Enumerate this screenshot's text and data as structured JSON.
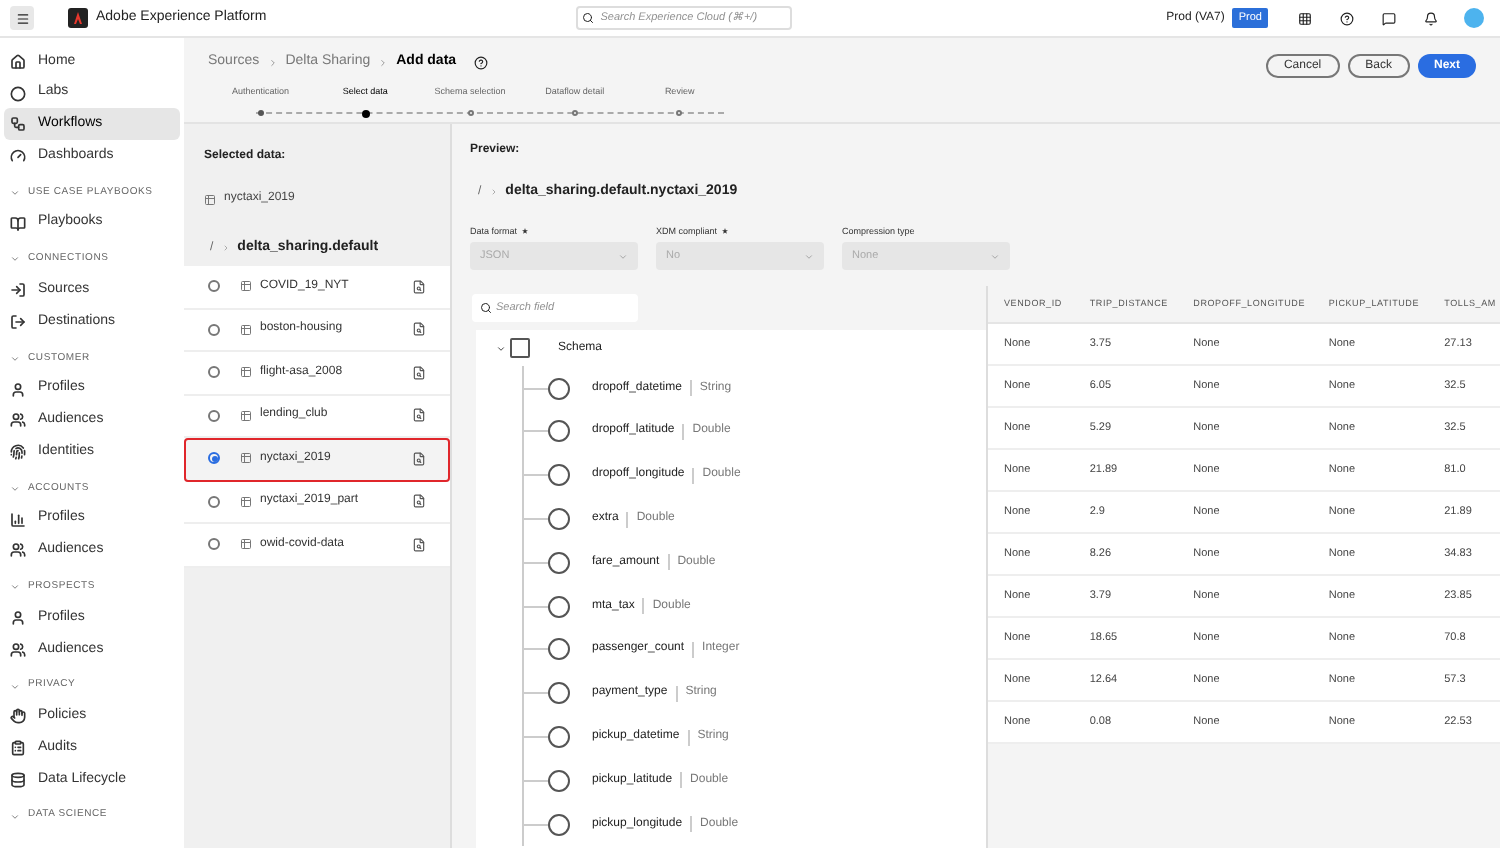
{
  "top_bar": {
    "title": "Adobe Experience Platform",
    "search": {
      "placeholder": "Search Experience Cloud (⌘+/)"
    },
    "sandbox": "Prod (VA7)",
    "badge": "Prod"
  },
  "sidebar": {
    "items": [
      {
        "label": "Home",
        "selected": false
      },
      {
        "label": "Labs",
        "selected": false
      },
      {
        "label": "Workflows",
        "selected": true
      },
      {
        "label": "Dashboards",
        "selected": false
      }
    ],
    "sections": [
      {
        "title": "USE CASE PLAYBOOKS",
        "expanded": true,
        "items": [
          {
            "label": "Playbooks",
            "selected": false
          }
        ]
      },
      {
        "title": "CONNECTIONS",
        "expanded": true,
        "items": [
          {
            "label": "Sources",
            "selected": false
          },
          {
            "label": "Destinations",
            "selected": false
          }
        ]
      },
      {
        "title": "CUSTOMER",
        "expanded": true,
        "items": [
          {
            "label": "Profiles",
            "selected": false
          },
          {
            "label": "Audiences",
            "selected": false
          },
          {
            "label": "Identities",
            "selected": false
          }
        ]
      },
      {
        "title": "ACCOUNTS",
        "expanded": true,
        "items": [
          {
            "label": "Profiles",
            "selected": false
          },
          {
            "label": "Audiences",
            "selected": false
          }
        ]
      },
      {
        "title": "PROSPECTS",
        "expanded": true,
        "items": [
          {
            "label": "Profiles",
            "selected": false
          },
          {
            "label": "Audiences",
            "selected": false
          }
        ]
      },
      {
        "title": "PRIVACY",
        "expanded": true,
        "items": [
          {
            "label": "Policies",
            "selected": false
          },
          {
            "label": "Audits",
            "selected": false
          },
          {
            "label": "Data Lifecycle",
            "selected": false
          }
        ]
      },
      {
        "title": "DATA SCIENCE",
        "expanded": true
      }
    ]
  },
  "breadcrumbs": [
    "Sources",
    "Delta Sharing",
    "Add data"
  ],
  "buttons": [
    {
      "label": "Cancel",
      "kind": "secondary"
    },
    {
      "label": "Back",
      "kind": "secondary"
    },
    {
      "label": "Next",
      "kind": "primary"
    }
  ],
  "steps": [
    {
      "label": "Authentication",
      "selected": false,
      "completed": true
    },
    {
      "label": "Select data",
      "selected": true,
      "completed": false
    },
    {
      "label": "Schema selection",
      "selected": false,
      "completed": false
    },
    {
      "label": "Dataflow detail",
      "selected": false,
      "completed": false
    },
    {
      "label": "Review",
      "selected": false,
      "completed": false
    }
  ],
  "selected_data": {
    "heading": "Selected data:",
    "item": "nyctaxi_2019"
  },
  "browser": {
    "root": "/",
    "path": "delta_sharing.default",
    "rows": [
      {
        "name": "COVID_19_NYT",
        "selected": false,
        "highlighted": false
      },
      {
        "name": "boston-housing",
        "selected": false,
        "highlighted": false
      },
      {
        "name": "flight-asa_2008",
        "selected": false,
        "highlighted": false
      },
      {
        "name": "lending_club",
        "selected": false,
        "highlighted": false
      },
      {
        "name": "nyctaxi_2019",
        "selected": true,
        "highlighted": true
      },
      {
        "name": "nyctaxi_2019_part",
        "selected": false,
        "highlighted": false
      },
      {
        "name": "owid-covid-data",
        "selected": false,
        "highlighted": false
      }
    ]
  },
  "preview": {
    "heading": "Preview:",
    "root": "/",
    "path": "delta_sharing.default.nyctaxi_2019",
    "dropdowns": [
      {
        "label": "Data format",
        "required": true,
        "value": "JSON"
      },
      {
        "label": "XDM compliant",
        "required": true,
        "value": "No"
      },
      {
        "label": "Compression type",
        "required": false,
        "value": "None"
      }
    ],
    "search": {
      "placeholder": "Search field"
    },
    "schema": {
      "label": "Schema",
      "expanded": true,
      "checked": false,
      "children": [
        {
          "name": "dropoff_datetime",
          "type": "String",
          "checked": false
        },
        {
          "name": "dropoff_latitude",
          "type": "Double",
          "checked": false
        },
        {
          "name": "dropoff_longitude",
          "type": "Double",
          "checked": false
        },
        {
          "name": "extra",
          "type": "Double",
          "checked": false
        },
        {
          "name": "fare_amount",
          "type": "Double",
          "checked": false
        },
        {
          "name": "mta_tax",
          "type": "Double",
          "checked": false
        },
        {
          "name": "passenger_count",
          "type": "Integer",
          "checked": false
        },
        {
          "name": "payment_type",
          "type": "String",
          "checked": false
        },
        {
          "name": "pickup_datetime",
          "type": "String",
          "checked": false
        },
        {
          "name": "pickup_latitude",
          "type": "Double",
          "checked": false
        },
        {
          "name": "pickup_longitude",
          "type": "Double",
          "checked": false
        }
      ]
    },
    "table": {
      "columns": [
        "VENDOR_ID",
        "TRIP_DISTANCE",
        "DROPOFF_LONGITUDE",
        "PICKUP_LATITUDE",
        "TOLLS_AM"
      ],
      "rows": [
        [
          "None",
          "3.75",
          "None",
          "None",
          "27.13"
        ],
        [
          "None",
          "6.05",
          "None",
          "None",
          "32.5"
        ],
        [
          "None",
          "5.29",
          "None",
          "None",
          "32.5"
        ],
        [
          "None",
          "21.89",
          "None",
          "None",
          "81.0"
        ],
        [
          "None",
          "2.9",
          "None",
          "None",
          "21.89"
        ],
        [
          "None",
          "8.26",
          "None",
          "None",
          "34.83"
        ],
        [
          "None",
          "3.79",
          "None",
          "None",
          "23.85"
        ],
        [
          "None",
          "18.65",
          "None",
          "None",
          "70.8"
        ],
        [
          "None",
          "12.64",
          "None",
          "None",
          "57.3"
        ],
        [
          "None",
          "0.08",
          "None",
          "None",
          "22.53"
        ]
      ]
    }
  }
}
